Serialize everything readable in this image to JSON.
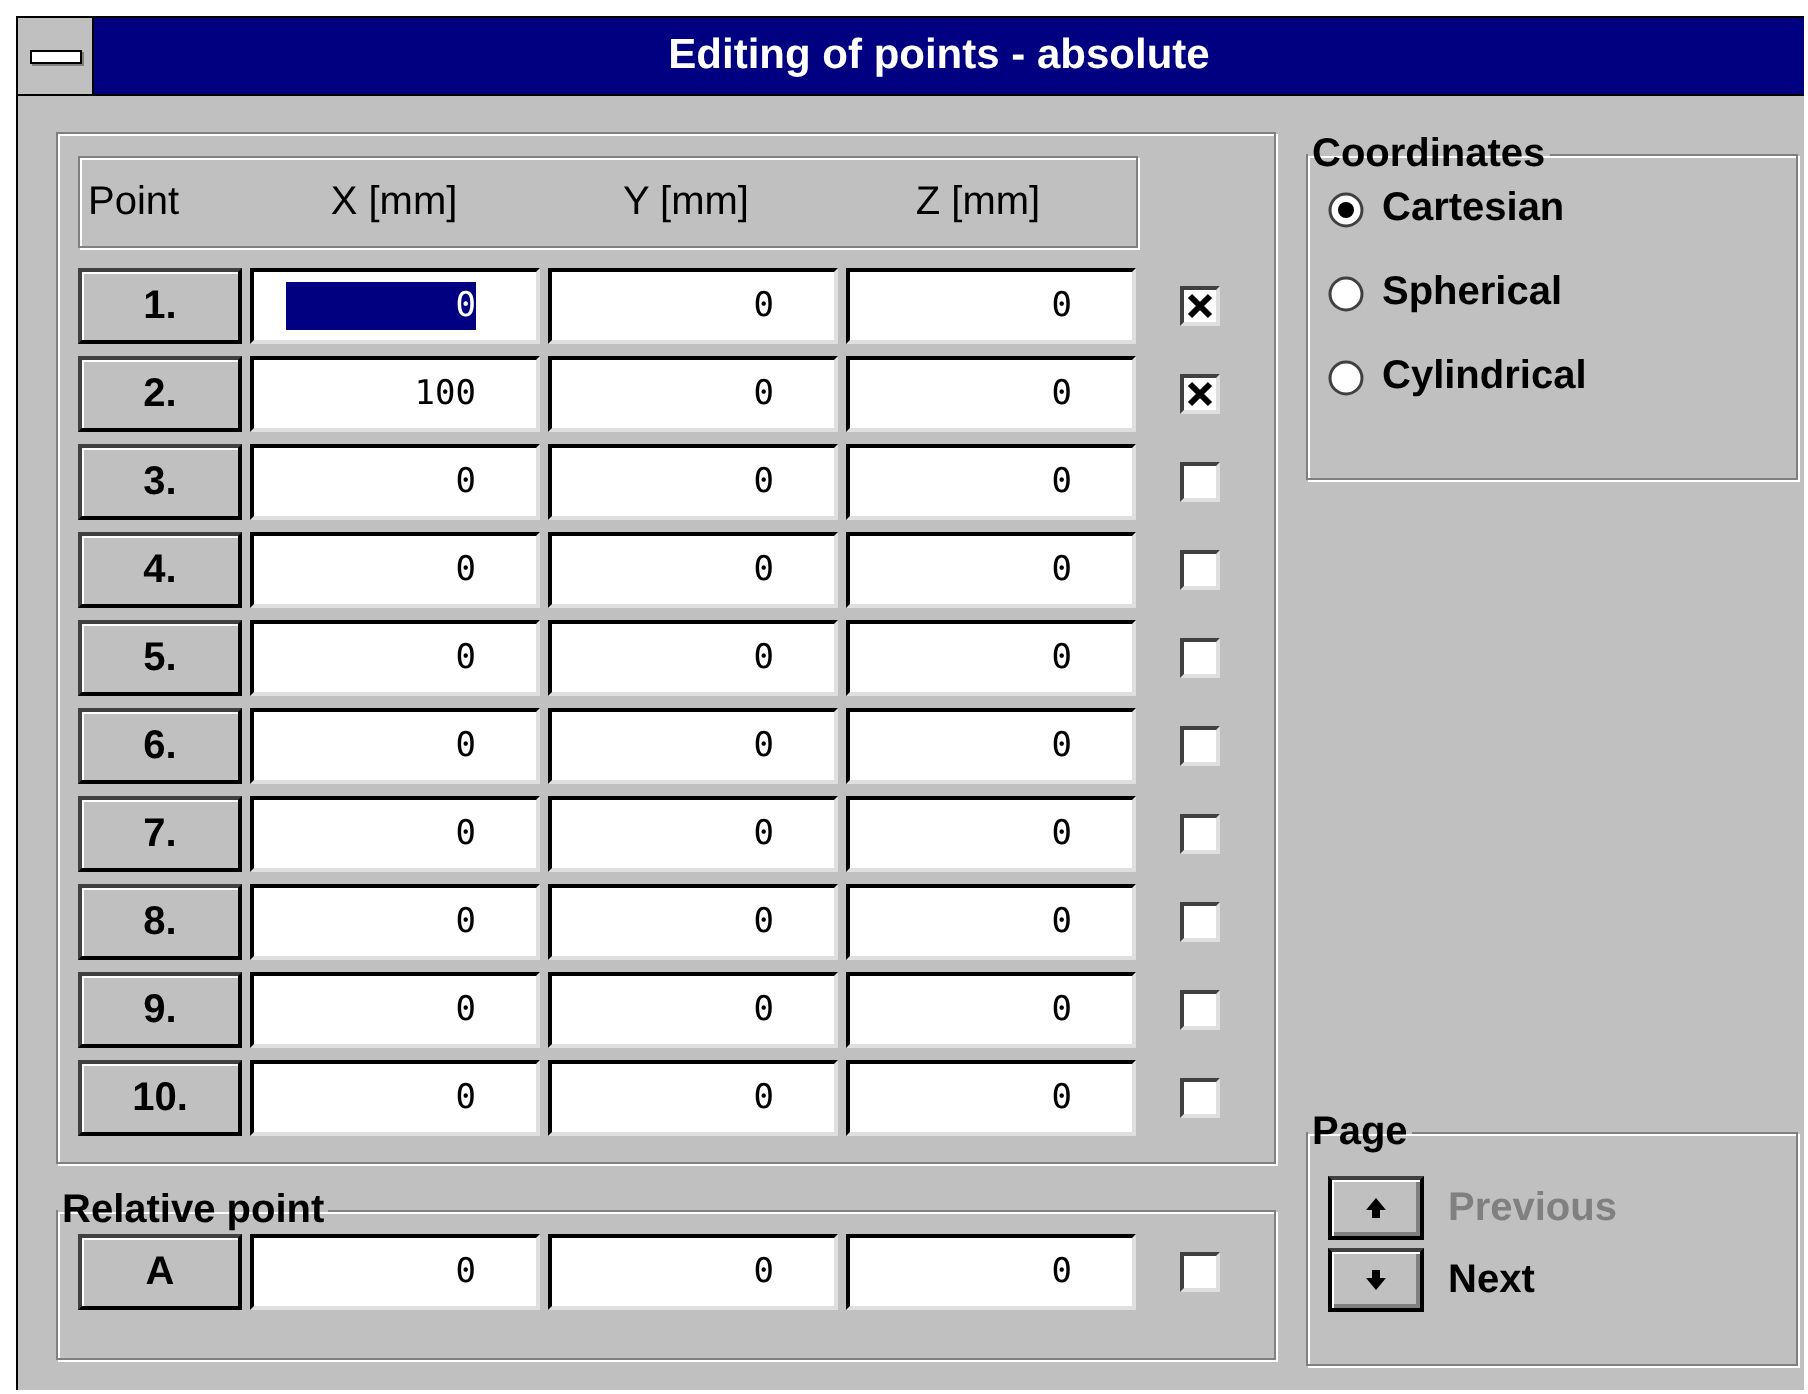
{
  "window": {
    "title": "Editing of points - absolute"
  },
  "table": {
    "columns": [
      "Point",
      "X [mm]",
      "Y [mm]",
      "Z [mm]"
    ],
    "rows": [
      {
        "point": "1.",
        "cells": [
          {
            "value": "0",
            "selected": true
          },
          {
            "value": "0",
            "selected": false
          },
          {
            "value": "0",
            "selected": false
          }
        ],
        "checked": true
      },
      {
        "point": "2.",
        "cells": [
          {
            "value": "100",
            "selected": false
          },
          {
            "value": "0",
            "selected": false
          },
          {
            "value": "0",
            "selected": false
          }
        ],
        "checked": true
      },
      {
        "point": "3.",
        "cells": [
          {
            "value": "0",
            "selected": false
          },
          {
            "value": "0",
            "selected": false
          },
          {
            "value": "0",
            "selected": false
          }
        ],
        "checked": false
      },
      {
        "point": "4.",
        "cells": [
          {
            "value": "0",
            "selected": false
          },
          {
            "value": "0",
            "selected": false
          },
          {
            "value": "0",
            "selected": false
          }
        ],
        "checked": false
      },
      {
        "point": "5.",
        "cells": [
          {
            "value": "0",
            "selected": false
          },
          {
            "value": "0",
            "selected": false
          },
          {
            "value": "0",
            "selected": false
          }
        ],
        "checked": false
      },
      {
        "point": "6.",
        "cells": [
          {
            "value": "0",
            "selected": false
          },
          {
            "value": "0",
            "selected": false
          },
          {
            "value": "0",
            "selected": false
          }
        ],
        "checked": false
      },
      {
        "point": "7.",
        "cells": [
          {
            "value": "0",
            "selected": false
          },
          {
            "value": "0",
            "selected": false
          },
          {
            "value": "0",
            "selected": false
          }
        ],
        "checked": false
      },
      {
        "point": "8.",
        "cells": [
          {
            "value": "0",
            "selected": false
          },
          {
            "value": "0",
            "selected": false
          },
          {
            "value": "0",
            "selected": false
          }
        ],
        "checked": false
      },
      {
        "point": "9.",
        "cells": [
          {
            "value": "0",
            "selected": false
          },
          {
            "value": "0",
            "selected": false
          },
          {
            "value": "0",
            "selected": false
          }
        ],
        "checked": false
      },
      {
        "point": "10.",
        "cells": [
          {
            "value": "0",
            "selected": false
          },
          {
            "value": "0",
            "selected": false
          },
          {
            "value": "0",
            "selected": false
          }
        ],
        "checked": false
      }
    ]
  },
  "relative_point": {
    "title": "Relative point",
    "point": "A",
    "cells": [
      {
        "value": "0",
        "selected": false
      },
      {
        "value": "0",
        "selected": false
      },
      {
        "value": "0",
        "selected": false
      }
    ],
    "checked": false
  },
  "coordinates": {
    "title": "Coordinates",
    "options": [
      {
        "label": "Cartesian",
        "selected": true
      },
      {
        "label": "Spherical",
        "selected": false
      },
      {
        "label": "Cylindrical",
        "selected": false
      }
    ]
  },
  "page": {
    "title": "Page",
    "buttons": [
      {
        "kind": "up",
        "label": "Previous",
        "disabled": true
      },
      {
        "kind": "down",
        "label": "Next",
        "disabled": false
      }
    ]
  }
}
